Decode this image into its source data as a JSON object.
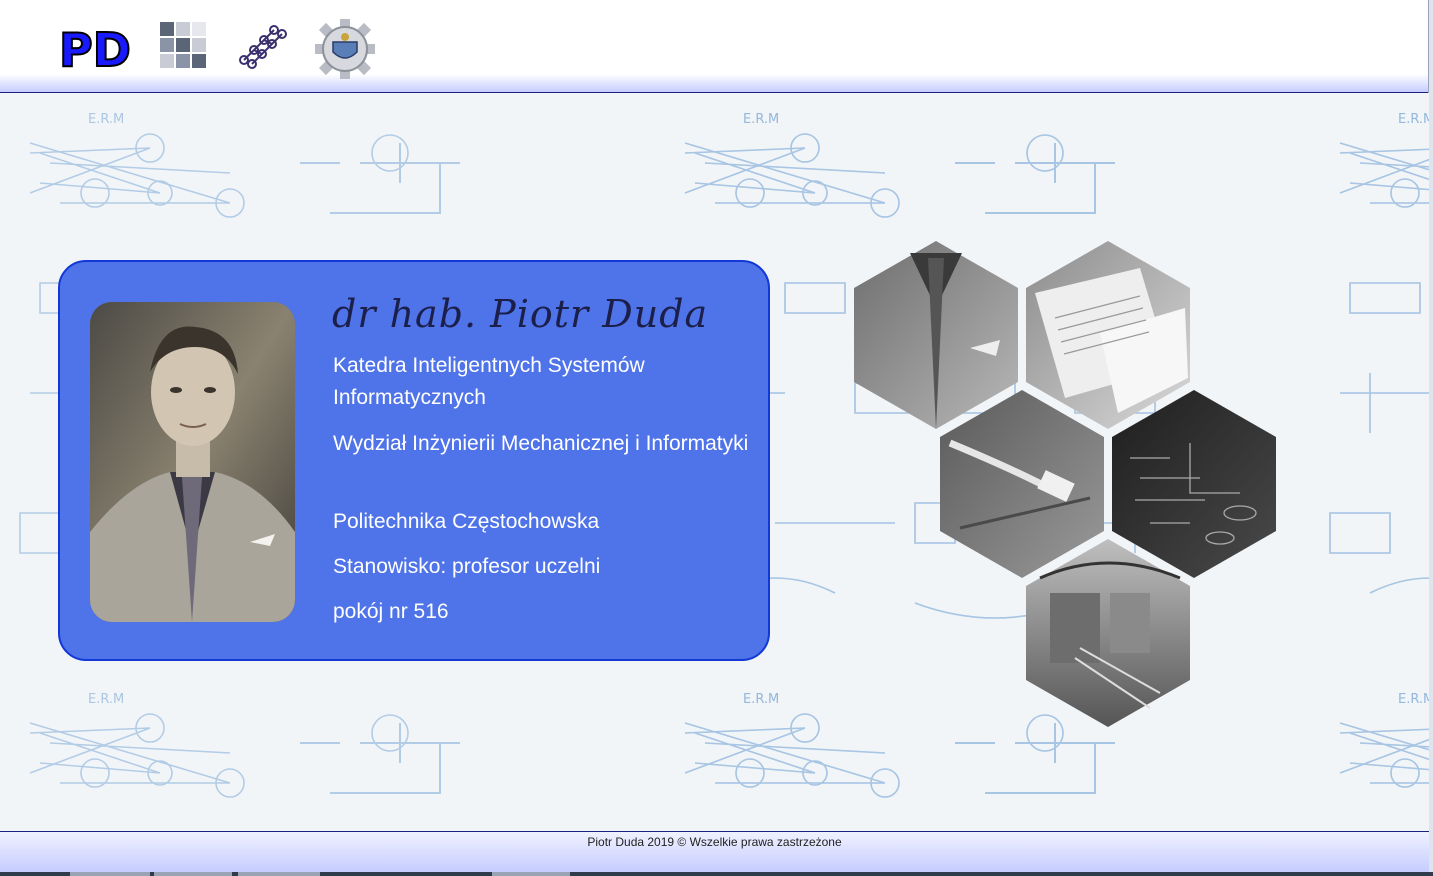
{
  "header": {
    "logos": [
      {
        "name": "pd-logo",
        "text": "PD"
      },
      {
        "name": "grid-logo"
      },
      {
        "name": "network-logo"
      },
      {
        "name": "university-crest-logo"
      }
    ]
  },
  "profile": {
    "name": "dr hab. Piotr Duda",
    "department": "Katedra Inteligentnych Systemów Informatycznych",
    "faculty": "Wydział Inżynierii Mechanicznej i Informatyki",
    "university": "Politechnika Częstochowska",
    "position": "Stanowisko: profesor uczelni",
    "room": "pokój nr 516"
  },
  "gallery": {
    "tiles": [
      "suit-photo",
      "papers-photo",
      "cable-photo",
      "blackboard-photo",
      "building-photo"
    ]
  },
  "footer": {
    "copyright": "Piotr Duda 2019 © Wszelkie prawa zastrzeżone"
  },
  "colors": {
    "card_bg": "#4f73e8",
    "card_border": "#1238d6",
    "name_color": "#1b1f4a"
  }
}
